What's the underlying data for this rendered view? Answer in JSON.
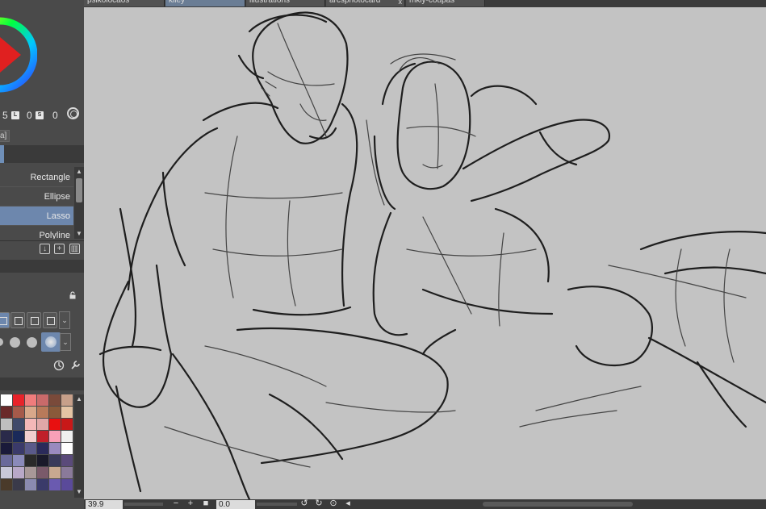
{
  "tabs": [
    {
      "label": "psikolocaos",
      "active": false,
      "closable": false
    },
    {
      "label": "kiley",
      "active": true,
      "closable": false
    },
    {
      "label": "illustrations",
      "active": false,
      "closable": false
    },
    {
      "label": "arcsphotocard",
      "active": false,
      "closable": true
    },
    {
      "label": "mkiy-coupas",
      "active": false,
      "closable": false
    }
  ],
  "color": {
    "hsv_values": [
      "5",
      "0",
      "0"
    ],
    "chip_labels": [
      "L",
      "S"
    ],
    "current_color": "#e02020",
    "wheel_icon": "color-wheel-icon"
  },
  "panel_tab_label": "a]",
  "tools": {
    "items": [
      {
        "label": "Rectangle",
        "active": false
      },
      {
        "label": "Ellipse",
        "active": false
      },
      {
        "label": "Lasso",
        "active": true
      },
      {
        "label": "Polyline",
        "active": false
      }
    ],
    "actions": [
      "import-icon",
      "add-icon",
      "trash-icon"
    ]
  },
  "palette": {
    "colors": [
      "#ffffff",
      "#e8222a",
      "#f07c7c",
      "#c96a6a",
      "#7a4a3a",
      "#c7a08a",
      "#6a2a2a",
      "#a55a4a",
      "#d8a88a",
      "#b87a5a",
      "#8a5a3a",
      "#e4c4a4",
      "#bfbfbf",
      "#404a6a",
      "#f4b8b8",
      "#e0a8a8",
      "#e81010",
      "#c81818",
      "#2a2a4a",
      "#1a2a5a",
      "#f0d0d0",
      "#c0202a",
      "#f8a0b8",
      "#f0f0f0",
      "#1a1a3a",
      "#3a3a6a",
      "#5a5a8a",
      "#2a2a5a",
      "#9a8abf",
      "#ffffff",
      "#6a6a9a",
      "#8a8aba",
      "#2a2a2a",
      "#1a1a2a",
      "#3a3a5a",
      "#5a4a7a",
      "#c8c8d8",
      "#b8a8c8",
      "#a89898",
      "#7a5a6a",
      "#c8a890",
      "#8a7a9a",
      "#4a3a2a",
      "#3a3a4a",
      "#8a8ab0",
      "#3a3a6a",
      "#6a5ab0",
      "#5a4a9a"
    ]
  },
  "status": {
    "zoom": "39.9",
    "rotation": "0.0",
    "buttons": [
      "minus",
      "plus",
      "fit",
      "rotate-left",
      "rotate-right",
      "reset",
      "flip"
    ]
  }
}
